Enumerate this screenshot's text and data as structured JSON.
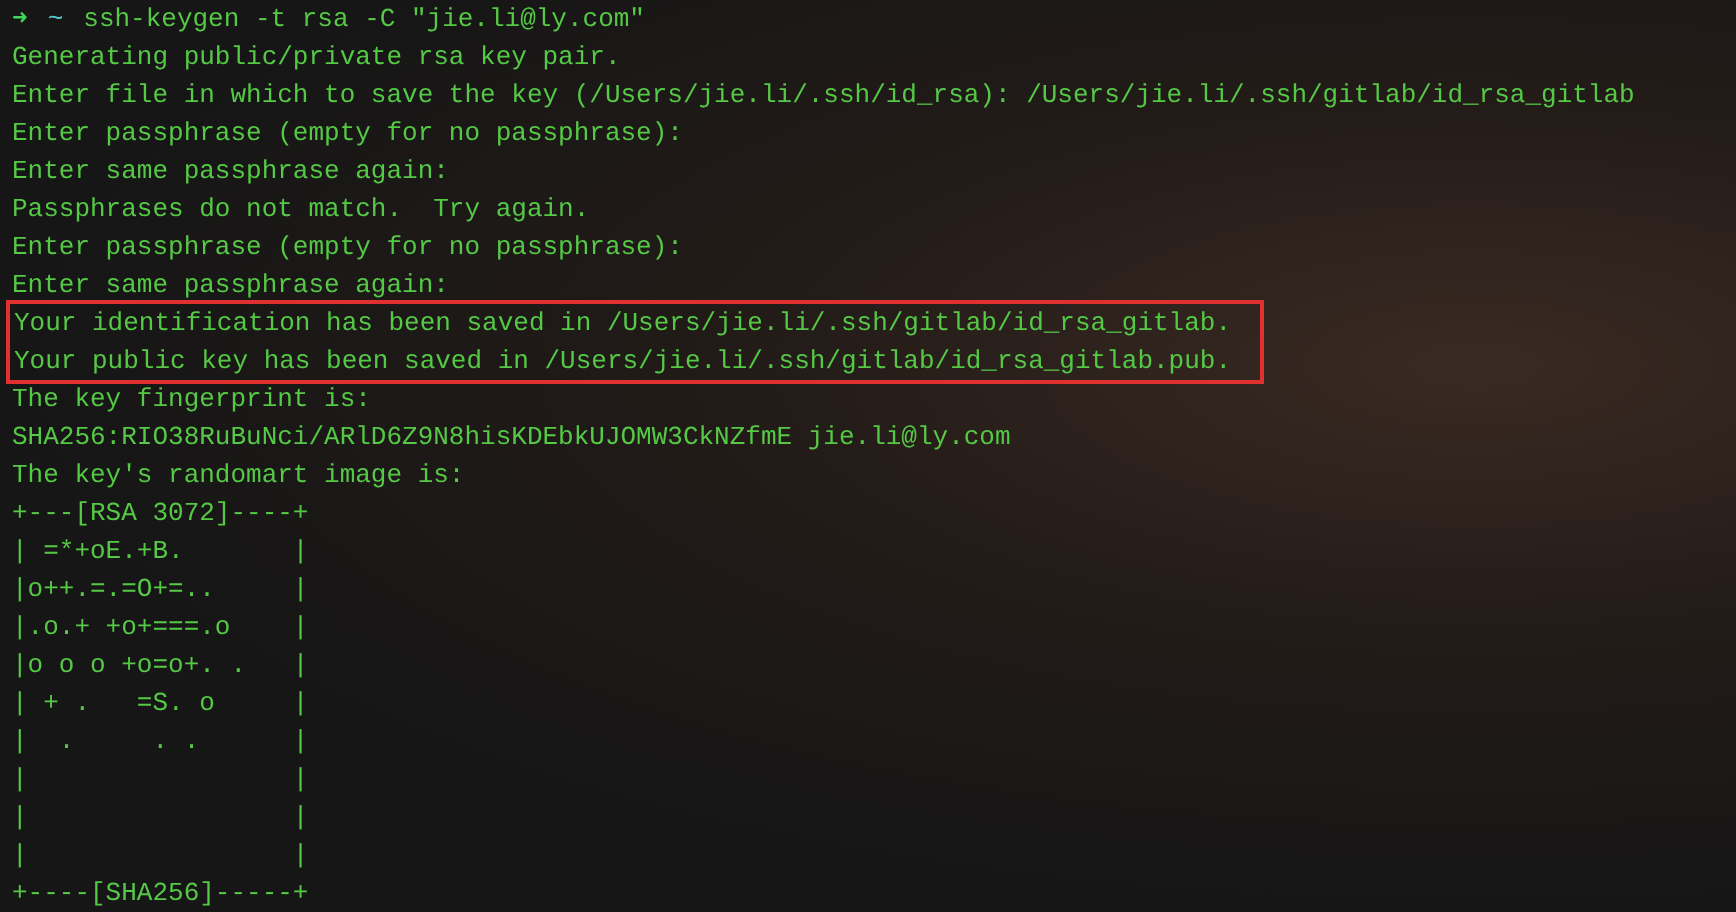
{
  "prompt": {
    "symbol": "➜",
    "cwd": "~",
    "command": "ssh-keygen -t rsa -C \"jie.li@ly.com\""
  },
  "lines": [
    {
      "text": "Generating public/private rsa key pair.",
      "highlighted": false
    },
    {
      "text": "Enter file in which to save the key (/Users/jie.li/.ssh/id_rsa): /Users/jie.li/.ssh/gitlab/id_rsa_gitlab",
      "highlighted": false
    },
    {
      "text": "Enter passphrase (empty for no passphrase):",
      "highlighted": false
    },
    {
      "text": "Enter same passphrase again:",
      "highlighted": false
    },
    {
      "text": "Passphrases do not match.  Try again.",
      "highlighted": false
    },
    {
      "text": "Enter passphrase (empty for no passphrase):",
      "highlighted": false
    },
    {
      "text": "Enter same passphrase again:",
      "highlighted": false
    },
    {
      "text": "Your identification has been saved in /Users/jie.li/.ssh/gitlab/id_rsa_gitlab.",
      "highlighted": true
    },
    {
      "text": "Your public key has been saved in /Users/jie.li/.ssh/gitlab/id_rsa_gitlab.pub.",
      "highlighted": true
    },
    {
      "text": "The key fingerprint is:",
      "highlighted": false
    },
    {
      "text": "SHA256:RIO38RuBuNci/ARlD6Z9N8hisKDEbkUJOMW3CkNZfmE jie.li@ly.com",
      "highlighted": false
    },
    {
      "text": "The key's randomart image is:",
      "highlighted": false
    },
    {
      "text": "+---[RSA 3072]----+",
      "highlighted": false
    },
    {
      "text": "| =*+oE.+B.       |",
      "highlighted": false
    },
    {
      "text": "|o++.=.=O+=..     |",
      "highlighted": false
    },
    {
      "text": "|.o.+ +o+===.o    |",
      "highlighted": false
    },
    {
      "text": "|o o o +o=o+. .   |",
      "highlighted": false
    },
    {
      "text": "| + .   =S. o     |",
      "highlighted": false
    },
    {
      "text": "|  .     . .      |",
      "highlighted": false
    },
    {
      "text": "|                 |",
      "highlighted": false
    },
    {
      "text": "|                 |",
      "highlighted": false
    },
    {
      "text": "|                 |",
      "highlighted": false
    },
    {
      "text": "+----[SHA256]-----+",
      "highlighted": false
    }
  ]
}
